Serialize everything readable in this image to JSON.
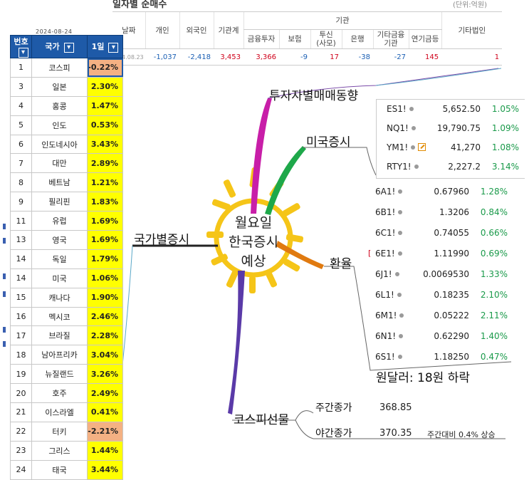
{
  "investor_table": {
    "title": "일자별 순매수",
    "unit": "(단위:억원)",
    "group_header": "기관",
    "headers": [
      "날짜",
      "개인",
      "외국인",
      "기관계",
      "금융투자",
      "보험",
      "투신\n(사모)",
      "은행",
      "기타금융\n기관",
      "연기금등",
      "기타법인"
    ],
    "row": [
      "24.08.23",
      "-1,037",
      "-2,418",
      "3,453",
      "3,366",
      "-9",
      "17",
      "-38",
      "-27",
      "145",
      "1"
    ]
  },
  "sheet": {
    "date_header": "2024-08-24",
    "headers": [
      "번호",
      "국가",
      "1일"
    ],
    "rows": [
      [
        "1",
        "코스피",
        "-0.22%"
      ],
      [
        "3",
        "일본",
        "2.30%"
      ],
      [
        "4",
        "홍콩",
        "1.47%"
      ],
      [
        "5",
        "인도",
        "0.53%"
      ],
      [
        "6",
        "인도네시아",
        "3.43%"
      ],
      [
        "7",
        "대만",
        "2.89%"
      ],
      [
        "8",
        "베트남",
        "1.21%"
      ],
      [
        "9",
        "필리핀",
        "1.83%"
      ],
      [
        "11",
        "유럽",
        "1.69%"
      ],
      [
        "13",
        "영국",
        "1.69%"
      ],
      [
        "14",
        "독일",
        "1.79%"
      ],
      [
        "14",
        "미국",
        "1.06%"
      ],
      [
        "15",
        "캐나다",
        "1.90%"
      ],
      [
        "16",
        "멕시코",
        "2.46%"
      ],
      [
        "17",
        "브라질",
        "2.28%"
      ],
      [
        "18",
        "남아프리카",
        "3.04%"
      ],
      [
        "19",
        "뉴질랜드",
        "3.26%"
      ],
      [
        "20",
        "호주",
        "2.49%"
      ],
      [
        "21",
        "이스라엘",
        "0.41%"
      ],
      [
        "22",
        "터키",
        "-2.21%"
      ],
      [
        "23",
        "그리스",
        "1.44%"
      ],
      [
        "24",
        "태국",
        "3.44%"
      ]
    ]
  },
  "mindmap": {
    "center": [
      "월요일",
      "한국증시",
      "예상"
    ],
    "branch_investor": "투자자별매매동향",
    "branch_us": "미국증시",
    "branch_country": "국가별증시",
    "branch_fx": "환율",
    "branch_kospi": "코스피선물",
    "fx_note": "원달러: 18원 하락",
    "kospi_day_label": "주간종가",
    "kospi_day_value": "368.85",
    "kospi_night_label": "야간종가",
    "kospi_night_value": "370.35",
    "kospi_note": "주간대비 0.4% 상승"
  },
  "us_indices": [
    {
      "sym": "ES1!",
      "value": "5,652.50",
      "chg": "1.05%"
    },
    {
      "sym": "NQ1!",
      "value": "19,790.75",
      "chg": "1.09%"
    },
    {
      "sym": "YM1!",
      "value": "41,270",
      "chg": "1.08%"
    },
    {
      "sym": "RTY1!",
      "value": "2,227.2",
      "chg": "3.14%"
    }
  ],
  "fx_rates": [
    {
      "sym": "6A1!",
      "value": "0.67960",
      "chg": "1.28%"
    },
    {
      "sym": "6B1!",
      "value": "1.3206",
      "chg": "0.84%"
    },
    {
      "sym": "6C1!",
      "value": "0.74055",
      "chg": "0.66%"
    },
    {
      "sym": "6E1!",
      "value": "1.11990",
      "chg": "0.69%"
    },
    {
      "sym": "6J1!",
      "value": "0.0069530",
      "chg": "1.33%"
    },
    {
      "sym": "6L1!",
      "value": "0.18235",
      "chg": "2.10%"
    },
    {
      "sym": "6M1!",
      "value": "0.05222",
      "chg": "2.11%"
    },
    {
      "sym": "6N1!",
      "value": "0.62290",
      "chg": "1.40%"
    },
    {
      "sym": "6S1!",
      "value": "1.18250",
      "chg": "0.47%"
    }
  ],
  "colors": {
    "sheet_header": "#1e5aa8",
    "pct_up_bg": "#ffff00",
    "pct_down_bg": "#f4b183",
    "branch_investor": "#c81ea8",
    "branch_us": "#1ea84a",
    "branch_fx": "#e07a10",
    "branch_kospi": "#5a3aa8",
    "branch_country": "#1a1a1a",
    "sun": "#f5c518",
    "positive_change": "#1a9a4a"
  }
}
